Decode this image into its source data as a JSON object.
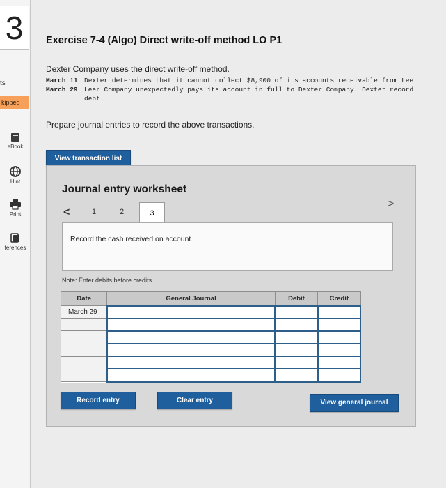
{
  "sidebar": {
    "question_number": "3",
    "points_label": "ts",
    "status_badge": "kipped",
    "tools": [
      {
        "label": "eBook",
        "icon": "book-icon"
      },
      {
        "label": "Hint",
        "icon": "globe-icon"
      },
      {
        "label": "Print",
        "icon": "printer-icon"
      },
      {
        "label": "ferences",
        "icon": "references-icon"
      }
    ]
  },
  "exercise": {
    "title": "Exercise 7-4 (Algo) Direct write-off method LO P1",
    "intro": "Dexter Company uses the direct write-off method.",
    "transactions": [
      {
        "date": "March 11",
        "text": "Dexter determines that it cannot collect $8,900 of its accounts receivable from Lee"
      },
      {
        "date": "March 29",
        "text": "Leer Company unexpectedly pays its account in full to Dexter Company. Dexter record",
        "continuation": "debt."
      }
    ],
    "prompt": "Prepare journal entries to record the above transactions.",
    "view_transactions_label": "View transaction list"
  },
  "worksheet": {
    "title": "Journal entry worksheet",
    "prev_arrow": "<",
    "next_arrow": ">",
    "pages": [
      "1",
      "2",
      "3"
    ],
    "active_page": "3",
    "instruction": "Record the cash received on account.",
    "note": "Note: Enter debits before credits.",
    "columns": [
      "Date",
      "General Journal",
      "Debit",
      "Credit"
    ],
    "rows": [
      {
        "date": "March 29"
      },
      {
        "date": ""
      },
      {
        "date": ""
      },
      {
        "date": ""
      },
      {
        "date": ""
      },
      {
        "date": ""
      }
    ],
    "record_label": "Record entry",
    "clear_label": "Clear entry",
    "view_journal_label": "View general journal"
  },
  "colors": {
    "button_blue": "#1f5f9e",
    "badge_orange": "#f6a05a",
    "cell_border_blue": "#2e5f8a"
  }
}
